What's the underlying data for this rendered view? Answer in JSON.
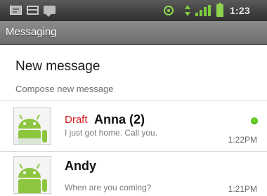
{
  "status_bar": {
    "time": "1:23",
    "icons": [
      "sms-notification-icon",
      "calendar-notification-icon",
      "chat-notification-icon",
      "gps-icon",
      "data-arrows-icon",
      "signal-icon",
      "battery-icon"
    ],
    "accent_color": "#7ecb3f"
  },
  "app": {
    "title": "Messaging"
  },
  "compose": {
    "title": "New message",
    "subtitle": "Compose new message"
  },
  "threads": [
    {
      "draft_label": "Draft",
      "name": "Anna (2)",
      "snippet": "I just got home. Call you.",
      "time": "1:22PM",
      "avatar": "android-avatar-icon",
      "online": true
    },
    {
      "name": "Andy",
      "snippet": "When are you coming?",
      "time": "1:21PM",
      "avatar": "android-avatar-icon"
    }
  ],
  "colors": {
    "draft": "#d41b1b",
    "online": "#6ad02a",
    "title_bar": "#7c7c7c"
  }
}
